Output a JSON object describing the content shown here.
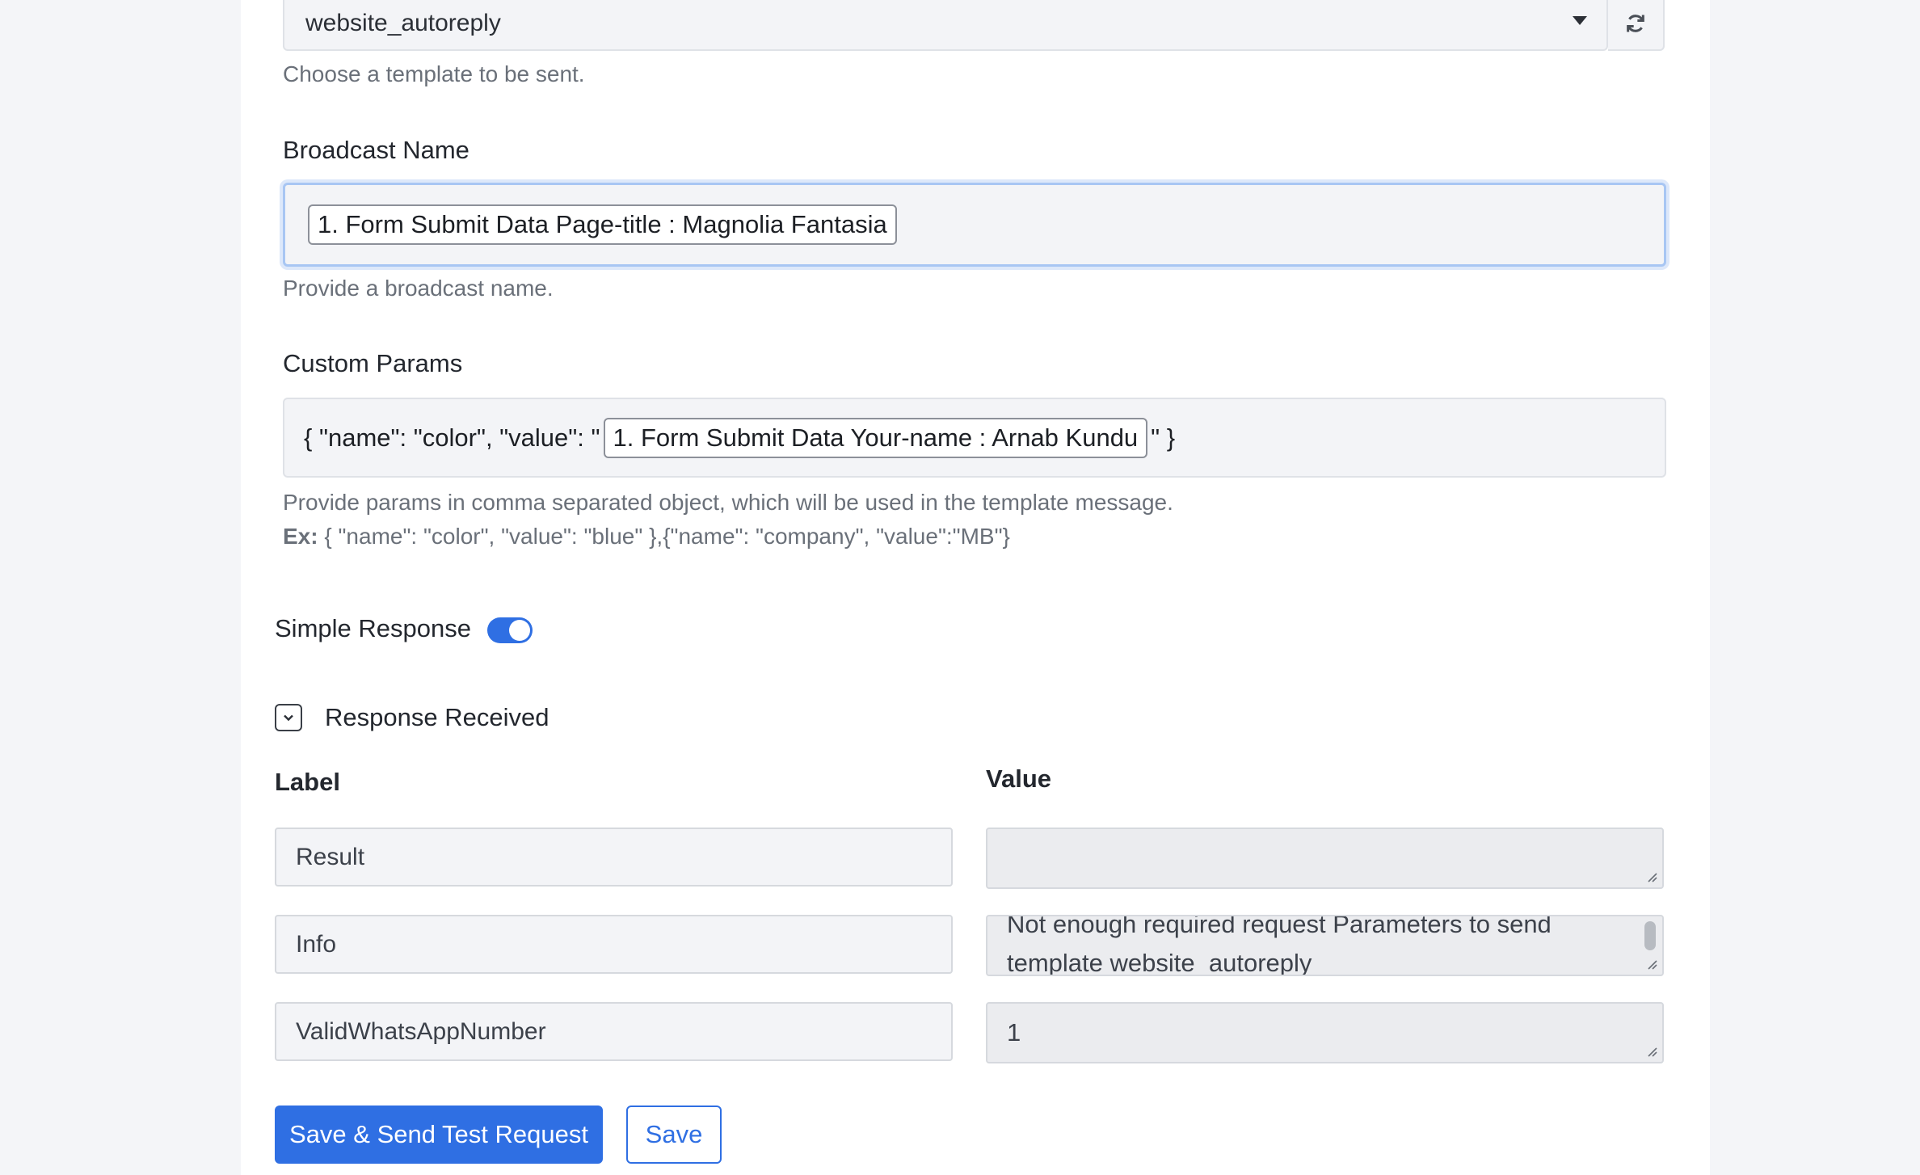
{
  "template": {
    "selected": "website_autoreply",
    "help": "Choose a template to be sent.",
    "refresh_icon": "refresh-icon"
  },
  "broadcast": {
    "label": "Broadcast Name",
    "chip": "1. Form Submit Data Page-title : Magnolia Fantasia",
    "help": "Provide a broadcast name."
  },
  "custom_params": {
    "label": "Custom Params",
    "prefix": "{ \"name\": \"color\", \"value\": \"",
    "chip": "1. Form Submit Data Your-name : Arnab Kundu",
    "suffix": "\" }",
    "help": "Provide params in comma separated object, which will be used in the template message.",
    "example_label": "Ex:",
    "example_text": " { \"name\": \"color\", \"value\": \"blue\" },{\"name\": \"company\", \"value\":\"MB\"}"
  },
  "simple_response": {
    "label": "Simple Response",
    "enabled": true
  },
  "response_received": {
    "label": "Response Received",
    "column_label": "Label",
    "column_value": "Value",
    "rows": [
      {
        "label": "Result",
        "value": ""
      },
      {
        "label": "Info",
        "value": "Not enough required request Parameters to send template website_autoreply"
      },
      {
        "label": "ValidWhatsAppNumber",
        "value": "1"
      }
    ]
  },
  "buttons": {
    "save_test": "Save & Send Test Request",
    "save": "Save"
  },
  "colors": {
    "primary": "#2f6fe3",
    "field_bg": "#f3f4f7",
    "page_bg": "#f4f5f8"
  }
}
